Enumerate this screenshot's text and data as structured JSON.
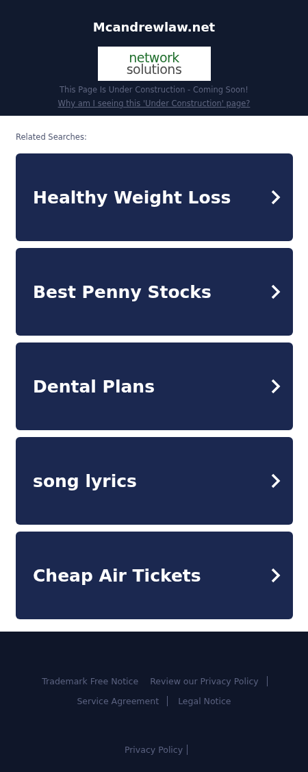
{
  "header": {
    "site_title": "Mcandrewlaw.net",
    "logo": [
      "network",
      "solutions"
    ],
    "notice": "This Page Is Under Construction - Coming Soon!",
    "why_link": "Why am I seeing this 'Under Construction' page?"
  },
  "related": {
    "heading": "Related Searches:",
    "items": [
      {
        "label": "Healthy Weight Loss"
      },
      {
        "label": "Best Penny Stocks"
      },
      {
        "label": "Dental Plans"
      },
      {
        "label": "song lyrics"
      },
      {
        "label": "Cheap Air Tickets"
      }
    ]
  },
  "footer": {
    "links": [
      {
        "label": "Trademark Free Notice",
        "divider": false
      },
      {
        "label": "Review our Privacy Policy",
        "divider": true
      },
      {
        "label": "Service Agreement",
        "divider": true
      },
      {
        "label": "Legal Notice",
        "divider": false
      }
    ],
    "bottom_link": "Privacy Policy"
  }
}
